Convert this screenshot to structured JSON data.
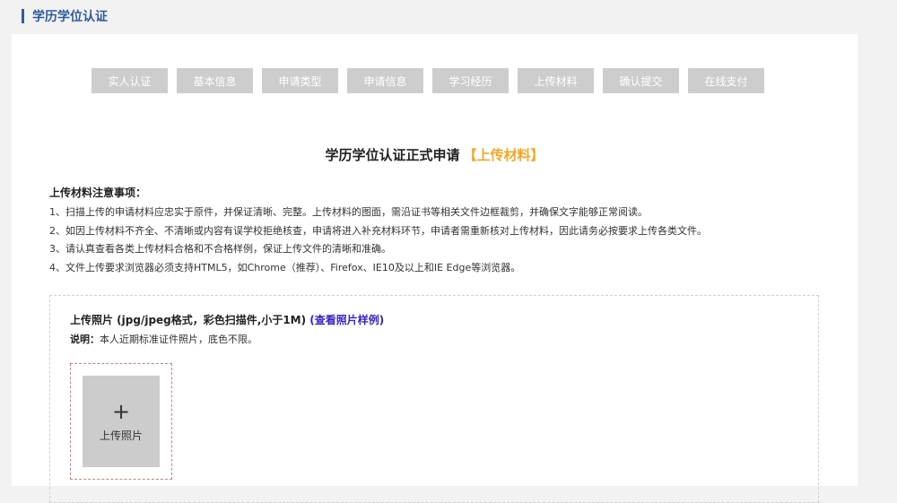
{
  "header": {
    "title": "学历学位认证"
  },
  "steps": [
    "实人认证",
    "基本信息",
    "申请类型",
    "申请信息",
    "学习经历",
    "上传材料",
    "确认提交",
    "在线支付"
  ],
  "form": {
    "title": "学历学位认证正式申请",
    "stage": "【上传材料】"
  },
  "notice": {
    "title": "上传材料注意事项：",
    "lines": [
      "1、扫描上传的申请材料应忠实于原件，并保证清晰、完整。上传材料的图面，需沿证书等相关文件边框裁剪，并确保文字能够正常阅读。",
      "2、如因上传材料不齐全、不清晰或内容有误学校拒绝核查，申请将进入补充材料环节，申请者需重新核对上传材料，因此请务必按要求上传各类文件。",
      "3、请认真查看各类上传材料合格和不合格样例，保证上传文件的清晰和准确。",
      "4、文件上传要求浏览器必须支持HTML5，如Chrome（推荐）、Firefox、IE10及以上和IE Edge等浏览器。"
    ]
  },
  "upload": {
    "title": "上传照片 (jpg/jpeg格式，彩色扫描件,小于1M)",
    "sample_link": "(查看照片样例)",
    "note_label": "说明：",
    "note_text": "本人近期标准证件照片，底色不限。",
    "plus_glyph": "+",
    "button_label": "上传照片"
  },
  "colors": {
    "header_accent": "#2f5a9e",
    "step_inactive": "#cdcdcd",
    "stage_accent": "#f5a623",
    "link": "#3b22c9",
    "upload_frame": "#e07a7a"
  }
}
